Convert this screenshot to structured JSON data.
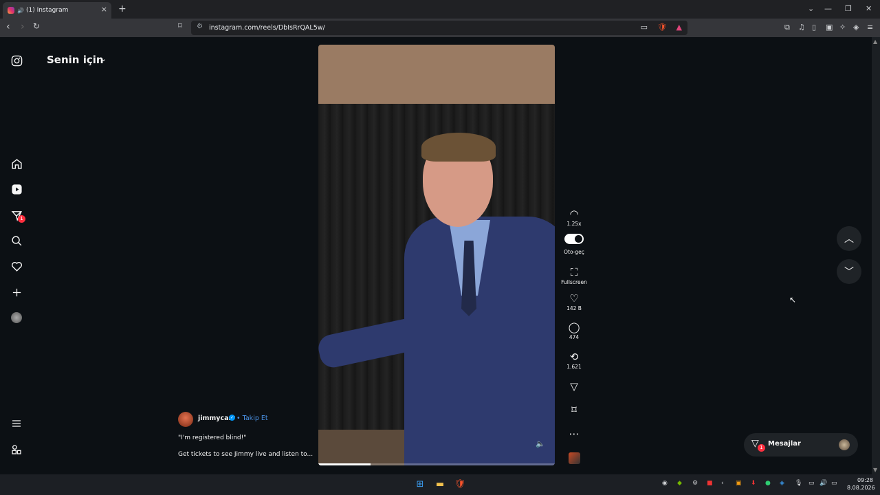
{
  "browser": {
    "tab_title": "(1) Instagram",
    "url": "instagram.com/reels/DbIsRrQAL5w/"
  },
  "sidebar": {
    "feed_title": "Senin için",
    "dm_badge": "1"
  },
  "reel": {
    "progress": 0.22,
    "controls": {
      "speed": "1.25x",
      "autoplay": "Oto-geç",
      "fullscreen": "Fullscreen",
      "likes": "142 B",
      "comments": "474",
      "reposts": "1.621"
    },
    "author": {
      "username": "jimmycarr",
      "follow_label": "• Takip Et"
    },
    "caption_line1": "\"I'm registered blind!\"",
    "caption_line2": "Get tickets to see Jimmy live and listen to..."
  },
  "messages": {
    "label": "Mesajlar",
    "badge": "1"
  },
  "taskbar": {
    "time": "09:28",
    "date": "8.08.2026"
  },
  "colors": {
    "background": "#0c1014",
    "accent": "#4a90e2",
    "badge": "#ff3040"
  }
}
